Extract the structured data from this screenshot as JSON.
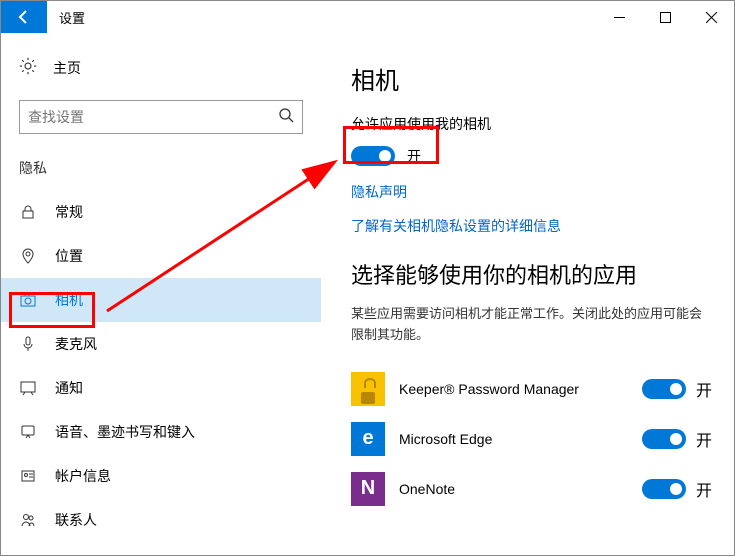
{
  "window": {
    "title": "设置"
  },
  "sidebar": {
    "home": "主页",
    "search_placeholder": "查找设置",
    "section": "隐私",
    "items": [
      {
        "label": "常规"
      },
      {
        "label": "位置"
      },
      {
        "label": "相机"
      },
      {
        "label": "麦克风"
      },
      {
        "label": "通知"
      },
      {
        "label": "语音、墨迹书写和键入"
      },
      {
        "label": "帐户信息"
      },
      {
        "label": "联系人"
      }
    ]
  },
  "main": {
    "title": "相机",
    "allow_label": "允许应用使用我的相机",
    "toggle_state": "开",
    "privacy_link": "隐私声明",
    "learn_more_link": "了解有关相机隐私设置的详细信息",
    "choose_title": "选择能够使用你的相机的应用",
    "choose_desc": "某些应用需要访问相机才能正常工作。关闭此处的应用可能会限制其功能。",
    "apps": [
      {
        "name": "Keeper® Password Manager",
        "state": "开"
      },
      {
        "name": "Microsoft Edge",
        "state": "开"
      },
      {
        "name": "OneNote",
        "state": "开"
      }
    ]
  }
}
